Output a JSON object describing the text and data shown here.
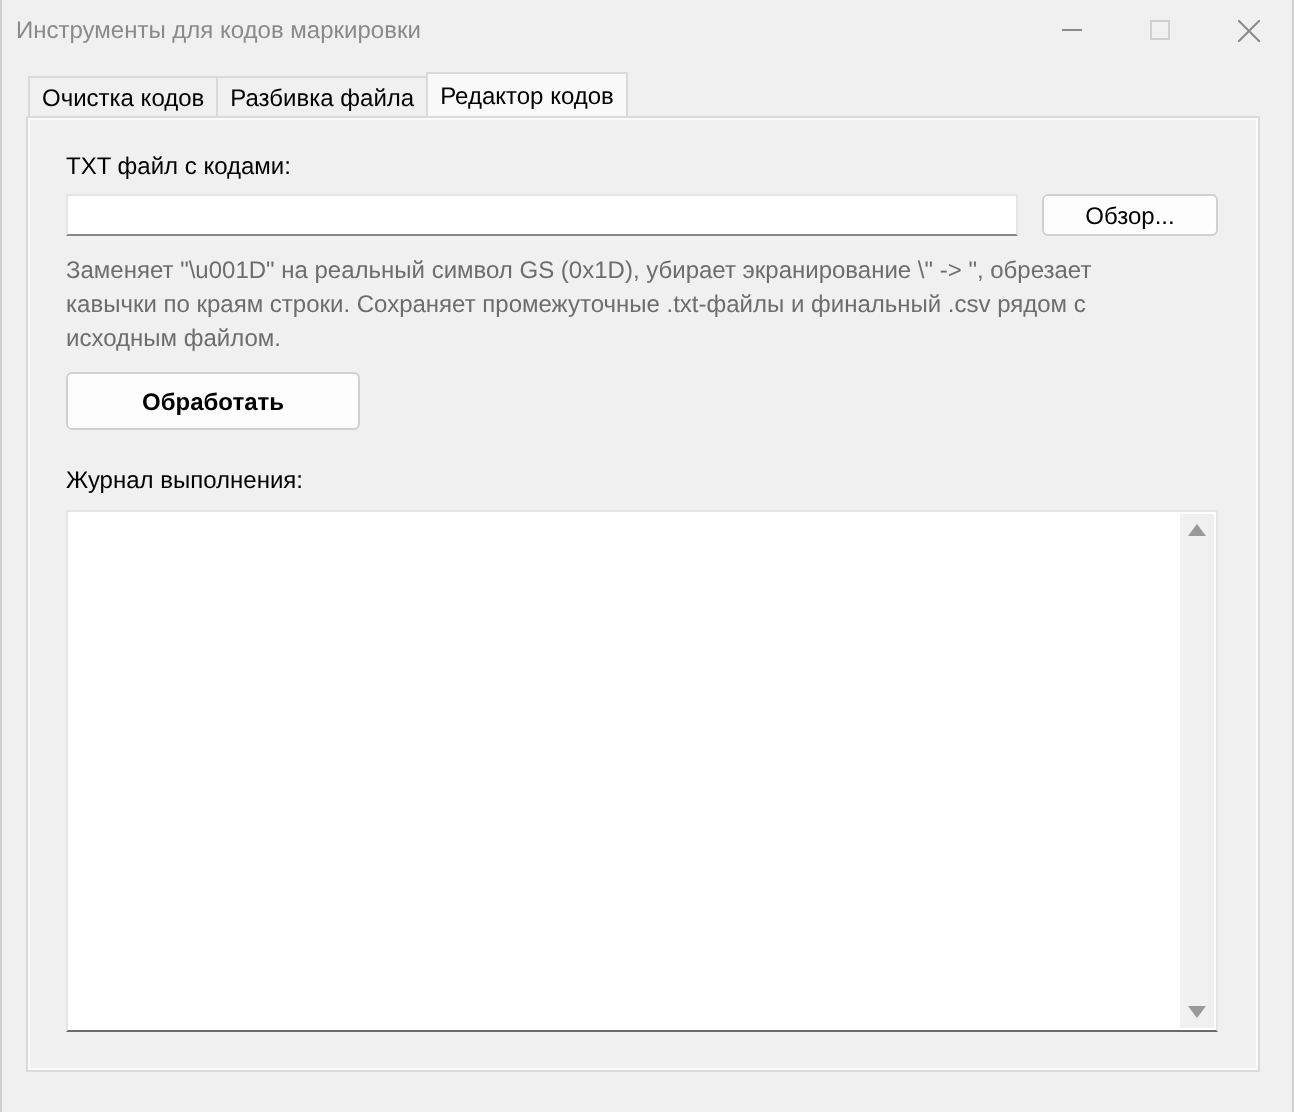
{
  "window": {
    "title": "Инструменты для кодов маркировки",
    "maximize_disabled": true
  },
  "tabs": [
    {
      "label": "Очистка кодов",
      "selected": false
    },
    {
      "label": "Разбивка файла",
      "selected": false
    },
    {
      "label": "Редактор кодов",
      "selected": true
    }
  ],
  "file_field": {
    "label": "TXT файл с кодами:",
    "browse_button": "Обзор..."
  },
  "description": "Заменяет \"\\u001D\" на реальный символ GS (0x1D), убирает экранирование \\\" -> \", обрезает кавычки по краям строки. Сохраняет промежуточные .txt-файлы и финальный .csv рядом с исходным файлом.",
  "process_button": "Обработать",
  "log": {
    "label": "Журнал выполнения:"
  }
}
